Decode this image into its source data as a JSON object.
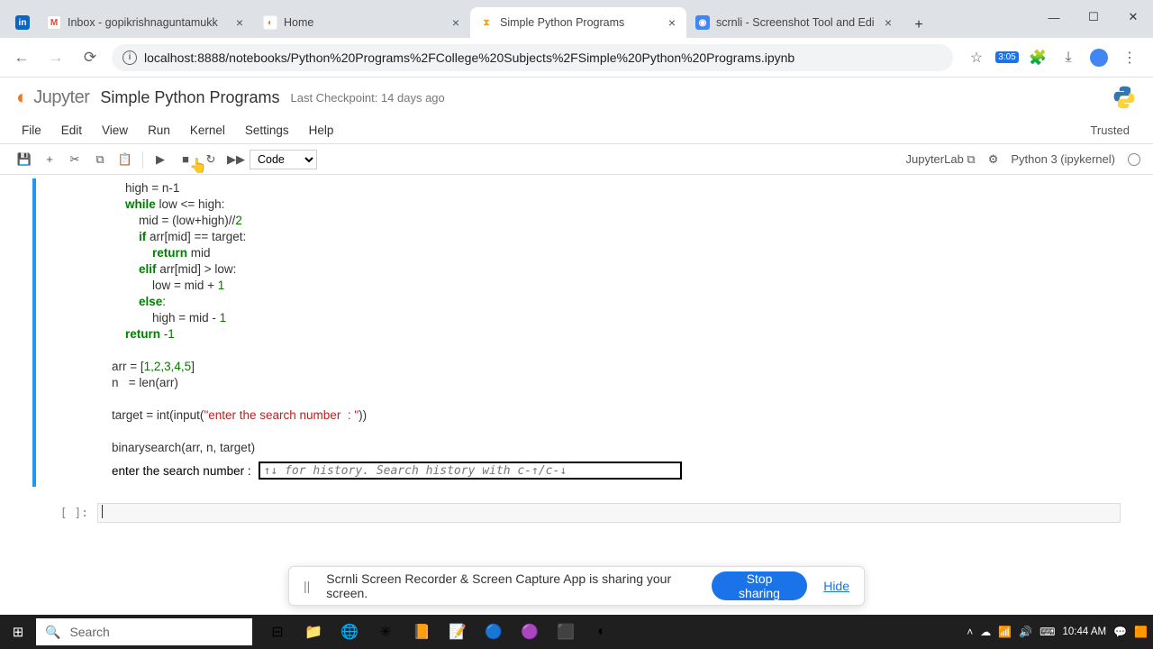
{
  "browser": {
    "tabs": [
      {
        "title": "",
        "icon": "linkedin"
      },
      {
        "title": "Inbox - gopikrishnaguntamukk",
        "icon": "gmail"
      },
      {
        "title": "Home",
        "icon": "jupyter"
      },
      {
        "title": "Simple Python Programs",
        "icon": "hourglass",
        "active": true
      },
      {
        "title": "scrnli - Screenshot Tool and Edi",
        "icon": "scrnli"
      }
    ],
    "url": "localhost:8888/notebooks/Python%20Programs%2FCollege%20Subjects%2FSimple%20Python%20Programs.ipynb",
    "ext_badge": "3:05"
  },
  "jupyter": {
    "title": "Simple Python Programs",
    "checkpoint": "Last Checkpoint: 14 days ago",
    "menus": [
      "File",
      "Edit",
      "View",
      "Run",
      "Kernel",
      "Settings",
      "Help"
    ],
    "trusted": "Trusted",
    "cell_type": "Code",
    "jupyterlab_link": "JupyterLab",
    "kernel": "Python 3 (ipykernel)"
  },
  "code": {
    "l1": "    high = n-1",
    "l2_a": "    ",
    "l2_kw": "while",
    "l2_b": " low <= high:",
    "l3_a": "        mid = (low+high)//",
    "l3_n": "2",
    "l4_a": "        ",
    "l4_kw": "if",
    "l4_b": " arr[mid] == target:",
    "l5_a": "            ",
    "l5_kw": "return",
    "l5_b": " mid",
    "l6_a": "        ",
    "l6_kw": "elif",
    "l6_b": " arr[mid] > low:",
    "l7_a": "            low = mid + ",
    "l7_n": "1",
    "l8_a": "        ",
    "l8_kw": "else",
    "l8_b": ":",
    "l9_a": "            high = mid - ",
    "l9_n": "1",
    "l10_a": "    ",
    "l10_kw": "return",
    "l10_b": " -",
    "l10_n": "1",
    "l11": "",
    "l12_a": "arr = [",
    "l12_n": "1,2,3,4,5",
    "l12_b": "]",
    "l13": "n   = len(arr)",
    "l14": "",
    "l15_a": "target = int(input(",
    "l15_s": "\"enter the search number  : \"",
    "l15_b": "))",
    "l16": "",
    "l17": "binarysearch(arr, n, target)"
  },
  "output": {
    "prompt": "enter the search number  : ",
    "placeholder": "↑↓ for history. Search history with c-↑/c-↓"
  },
  "empty_prompt": "[ ]:",
  "share": {
    "text": "Scrnli Screen Recorder & Screen Capture App is sharing your screen.",
    "stop": "Stop sharing",
    "hide": "Hide"
  },
  "taskbar": {
    "search": "Search",
    "time": "10:44 AM",
    "date": ""
  }
}
